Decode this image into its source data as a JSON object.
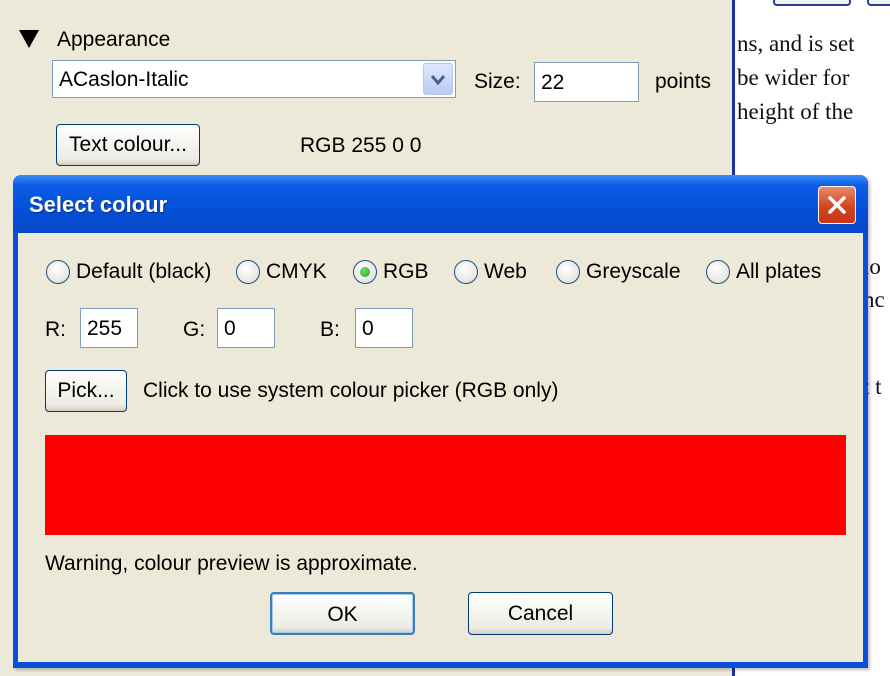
{
  "background": {
    "appearance_label": "Appearance",
    "font_value": "ACaslon-Italic",
    "size_label": "Size:",
    "size_value": "22",
    "points_label": "points",
    "text_colour_button": "Text colour...",
    "current_colour_text": "RGB 255 0 0"
  },
  "document": {
    "lines": [
      "ns, and is set",
      " be wider for",
      "height of the",
      "lo",
      "nc",
      "t t"
    ]
  },
  "dialog": {
    "title": "Select colour",
    "modes": [
      {
        "label": "Default (black)",
        "selected": false
      },
      {
        "label": "CMYK",
        "selected": false
      },
      {
        "label": "RGB",
        "selected": true
      },
      {
        "label": "Web",
        "selected": false
      },
      {
        "label": "Greyscale",
        "selected": false
      },
      {
        "label": "All plates",
        "selected": false
      }
    ],
    "r_label": "R:",
    "r_value": "255",
    "g_label": "G:",
    "g_value": "0",
    "b_label": "B:",
    "b_value": "0",
    "pick_button": "Pick...",
    "pick_hint": "Click to use system colour picker (RGB only)",
    "preview_color": "#ff0000",
    "warning": "Warning, colour preview is approximate.",
    "ok_button": "OK",
    "cancel_button": "Cancel"
  }
}
